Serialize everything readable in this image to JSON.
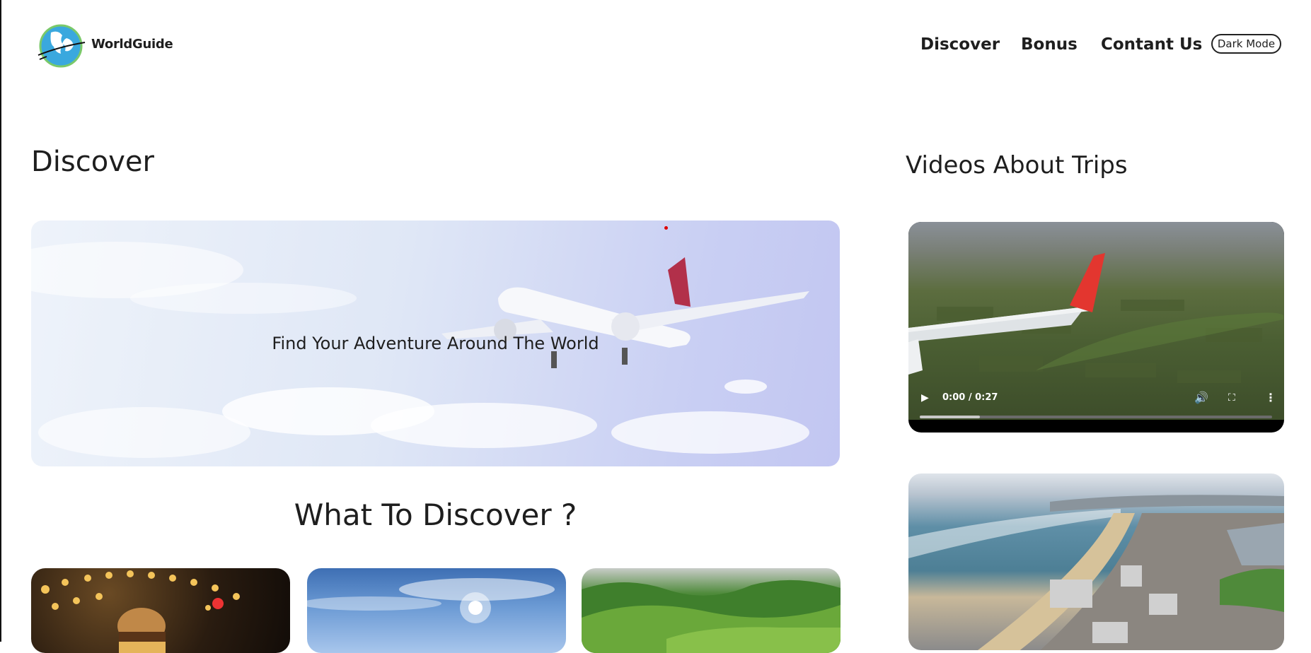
{
  "header": {
    "brand": "WorldGuide",
    "logo_icon": "globe-icon",
    "nav": [
      "Discover",
      "Bonus",
      "Contant Us"
    ],
    "dark_mode_label": "Dark Mode"
  },
  "main": {
    "title": "Discover",
    "hero_text": "Find Your Adventure Around The World",
    "what_title": "What To Discover ?",
    "cards": [
      "food-image",
      "sky-image",
      "hills-image"
    ]
  },
  "sidebar": {
    "title": "Videos About Trips",
    "videos": [
      {
        "time": "0:00 / 0:27",
        "progress": 0.17
      },
      {
        "thumbnail": "coastline-aerial-image"
      }
    ]
  },
  "colors": {
    "text": "#1e1e1e",
    "background": "#ffffff",
    "accent_logo": "#4db6e8"
  }
}
